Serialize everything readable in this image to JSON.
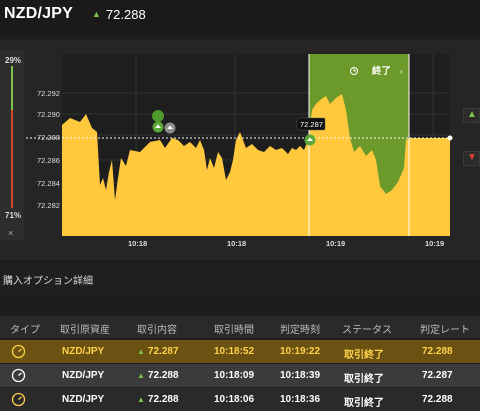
{
  "header": {
    "pair": "NZD/JPY",
    "rate": "72.288",
    "arrow_icon": "up-arrow-icon"
  },
  "gauge": {
    "top_pct": "29%",
    "bottom_pct": "71%",
    "close": "×",
    "top_fraction": 0.29,
    "up_color": "#7ec24a",
    "down_color": "#d2452b"
  },
  "chart": {
    "y_ticks": [
      "72.292",
      "72.290",
      "72.288",
      "72.286",
      "72.284",
      "72.282"
    ],
    "x_ticks": [
      "10:18",
      "10:18",
      "10:19",
      "10:19"
    ],
    "current_label": "72.287",
    "end_label": "終了",
    "timer_icon": "timer-icon",
    "fill_color": "#ffc83d",
    "window_color": "#6b9a2a"
  },
  "chart_data": {
    "type": "area",
    "y_unit": "NZD/JPY rate",
    "ylim": [
      72.28,
      72.294
    ],
    "x_ticks": [
      "10:18",
      "10:18",
      "10:19",
      "10:19"
    ],
    "markers": [
      {
        "price": 72.2888,
        "kind": "buy-up"
      },
      {
        "price": 72.2888,
        "kind": "buy-neutral"
      },
      {
        "price": 72.2873,
        "kind": "buy-up"
      }
    ],
    "current": 72.287,
    "line": 72.2877
  },
  "side": {
    "up_icon": "up-arrow-icon",
    "down_icon": "down-arrow-icon"
  },
  "section": {
    "title": "購入オプション詳細"
  },
  "table": {
    "headers": [
      "タイプ",
      "取引原資産",
      "取引内容",
      "取引時間",
      "判定時刻",
      "ステータス",
      "判定レート"
    ],
    "rows": [
      {
        "type_icon": "clock-icon",
        "asset": "NZD/JPY",
        "content": "72.287",
        "time": "10:18:52",
        "judge": "10:19:22",
        "status": "取引終了",
        "rate": "72.288"
      },
      {
        "type_icon": "clock-icon",
        "asset": "NZD/JPY",
        "content": "72.288",
        "time": "10:18:09",
        "judge": "10:18:39",
        "status": "取引終了",
        "rate": "72.287"
      },
      {
        "type_icon": "clock-icon",
        "asset": "NZD/JPY",
        "content": "72.288",
        "time": "10:18:06",
        "judge": "10:18:36",
        "status": "取引終了",
        "rate": "72.288"
      }
    ]
  }
}
